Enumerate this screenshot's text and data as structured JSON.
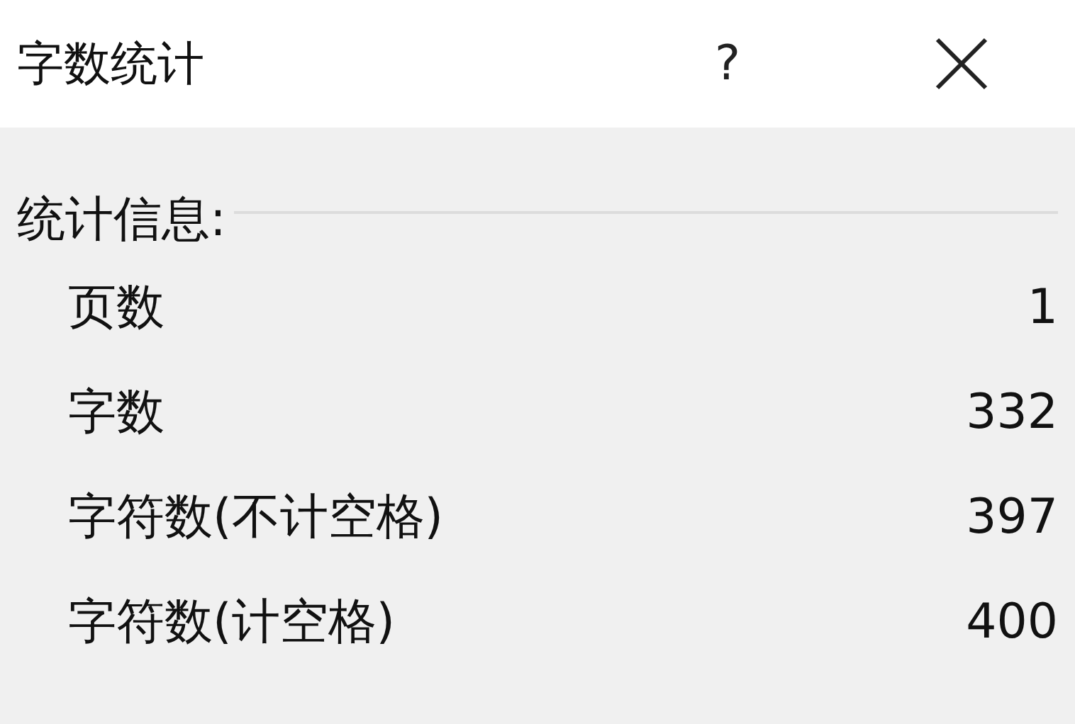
{
  "window": {
    "title": "字数统计",
    "help": "?"
  },
  "section": {
    "label": "统计信息:"
  },
  "stats": [
    {
      "label": "页数",
      "value": "1"
    },
    {
      "label": "字数",
      "value": "332"
    },
    {
      "label": "字符数(不计空格)",
      "value": "397"
    },
    {
      "label": "字符数(计空格)",
      "value": "400"
    }
  ]
}
